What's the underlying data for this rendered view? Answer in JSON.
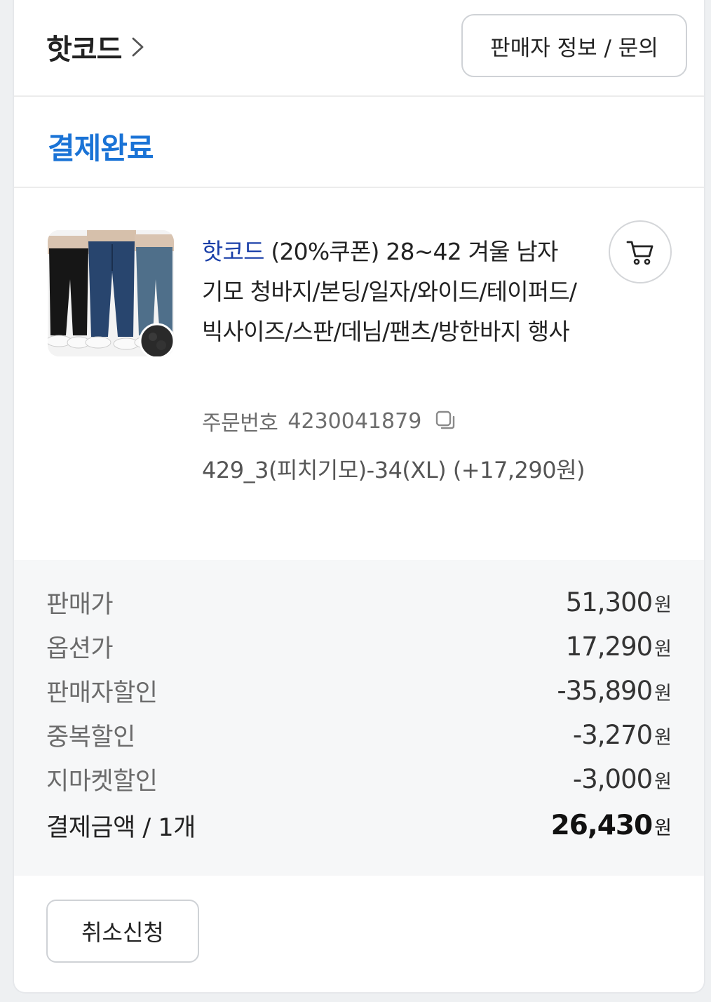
{
  "header": {
    "seller_name": "핫코드",
    "seller_info_button": "판매자 정보 / 문의"
  },
  "status": {
    "label": "결제완료"
  },
  "product": {
    "brand": "핫코드",
    "title": "(20%쿠폰) 28~42 겨울 남자 기모 청바지/본딩/일자/와이드/테이퍼드/빅사이즈/스판/데님/팬츠/방한바지 행사",
    "order_label": "주문번호",
    "order_number": "4230041879",
    "option": "429_3(피치기모)-34(XL) (+17,290원)",
    "thumbnail_icon": "jeans-product-image",
    "cart_icon": "cart-icon",
    "copy_icon": "copy-icon"
  },
  "prices": {
    "unit": "원",
    "rows": [
      {
        "label": "판매가",
        "value": "51,300"
      },
      {
        "label": "옵션가",
        "value": "17,290"
      },
      {
        "label": "판매자할인",
        "value": "-35,890"
      },
      {
        "label": "중복할인",
        "value": "-3,270"
      },
      {
        "label": "지마켓할인",
        "value": "-3,000"
      }
    ],
    "total": {
      "label": "결제금액 / 1개",
      "value": "26,430"
    }
  },
  "actions": {
    "cancel_button": "취소신청"
  },
  "colors": {
    "accent": "#1a73d6",
    "brand": "#1a3fa8",
    "panel_bg": "#f6f7f8"
  }
}
